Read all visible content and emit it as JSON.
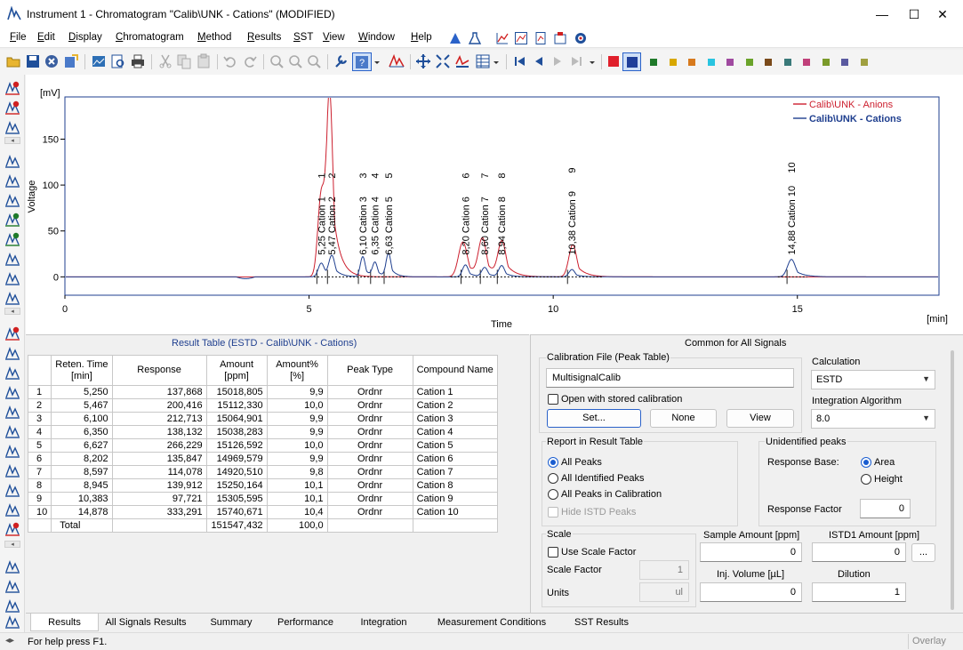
{
  "window": {
    "title": "Instrument 1 - Chromatogram \"Calib\\UNK - Cations\" (MODIFIED)",
    "minimize": "—",
    "maximize": "☐",
    "close": "✕"
  },
  "menu": [
    "File",
    "Edit",
    "Display",
    "Chromatogram",
    "Method",
    "Results",
    "SST",
    "View",
    "Window",
    "Help"
  ],
  "toolbar": {
    "swatch_colors": [
      "#e0202c",
      "#1f3f9a",
      "#1f7a2a",
      "#d8a800",
      "#d77a1e",
      "#29c4e0",
      "#a04aa0",
      "#6aa32a",
      "#7a4a1a",
      "#3a7a7a",
      "#c0407a",
      "#7a9a2a",
      "#5a5aa0",
      "#a0a040"
    ]
  },
  "chart": {
    "y_unit": "[mV]",
    "x_unit": "[min]",
    "y_label": "Voltage",
    "x_label": "Time",
    "legend": [
      {
        "name": "Calib\\UNK - Anions",
        "color": "#cc1f2e"
      },
      {
        "name": "Calib\\UNK - Cations",
        "color": "#1f3f8f"
      }
    ]
  },
  "chart_data": {
    "type": "line",
    "xlim": [
      0,
      17.9
    ],
    "ylim": [
      -20,
      196
    ],
    "x_ticks": [
      0,
      5,
      10,
      15
    ],
    "y_ticks": [
      0,
      50,
      100,
      150
    ],
    "grid": false,
    "legend_position": "top-right",
    "series": [
      {
        "name": "Calib\\UNK - Anions",
        "color": "#cc1f2e",
        "peaks": [
          {
            "t": 5.25,
            "h": 90,
            "w": 0.07
          },
          {
            "t": 5.42,
            "h": 188,
            "w": 0.065
          },
          {
            "t": 8.15,
            "h": 38,
            "w": 0.09
          },
          {
            "t": 8.55,
            "h": 40,
            "w": 0.08
          },
          {
            "t": 8.95,
            "h": 37,
            "w": 0.08
          },
          {
            "t": 10.4,
            "h": 35,
            "w": 0.08
          }
        ]
      },
      {
        "name": "Calib\\UNK - Cations",
        "color": "#1f3f8f",
        "peaks": [
          {
            "t": 5.25,
            "h": 15,
            "w": 0.06
          },
          {
            "t": 5.467,
            "h": 22,
            "w": 0.06
          },
          {
            "t": 6.1,
            "h": 22,
            "w": 0.05
          },
          {
            "t": 6.35,
            "h": 15,
            "w": 0.05
          },
          {
            "t": 6.627,
            "h": 25,
            "w": 0.05
          },
          {
            "t": 8.202,
            "h": 13,
            "w": 0.06
          },
          {
            "t": 8.597,
            "h": 10,
            "w": 0.06
          },
          {
            "t": 8.945,
            "h": 12,
            "w": 0.06
          },
          {
            "t": 10.383,
            "h": 8,
            "w": 0.06
          },
          {
            "t": 14.878,
            "h": 19,
            "w": 0.08
          }
        ]
      }
    ],
    "peak_labels": [
      {
        "t": 5.25,
        "text": "5,25 Cation 1",
        "num": "1"
      },
      {
        "t": 5.467,
        "text": "5,47 Cation 2",
        "num": "2"
      },
      {
        "t": 6.1,
        "text": "6,10 Cation 3",
        "num": "3"
      },
      {
        "t": 6.35,
        "text": "6,35 Cation 4",
        "num": "4"
      },
      {
        "t": 6.627,
        "text": "6,63 Cation 5",
        "num": "5"
      },
      {
        "t": 8.202,
        "text": "8,20 Cation 6",
        "num": "6"
      },
      {
        "t": 8.597,
        "text": "8,60 Cation 7",
        "num": "7"
      },
      {
        "t": 8.945,
        "text": "8,94 Cation 8",
        "num": "8"
      },
      {
        "t": 10.383,
        "text": "10,38 Cation 9",
        "num": "9"
      },
      {
        "t": 14.878,
        "text": "14,88 Cation 10",
        "num": "10"
      }
    ]
  },
  "result_table": {
    "title": "Result Table (ESTD - Calib\\UNK - Cations)",
    "headers": [
      "",
      "Reten. Time\n[min]",
      "Response",
      "Amount\n[ppm]",
      "Amount%\n[%]",
      "Peak Type",
      "Compound Name"
    ],
    "rows": [
      [
        "1",
        "5,250",
        "137,868",
        "15018,805",
        "9,9",
        "Ordnr",
        "Cation 1"
      ],
      [
        "2",
        "5,467",
        "200,416",
        "15112,330",
        "10,0",
        "Ordnr",
        "Cation 2"
      ],
      [
        "3",
        "6,100",
        "212,713",
        "15064,901",
        "9,9",
        "Ordnr",
        "Cation 3"
      ],
      [
        "4",
        "6,350",
        "138,132",
        "15038,283",
        "9,9",
        "Ordnr",
        "Cation 4"
      ],
      [
        "5",
        "6,627",
        "266,229",
        "15126,592",
        "10,0",
        "Ordnr",
        "Cation 5"
      ],
      [
        "6",
        "8,202",
        "135,847",
        "14969,579",
        "9,9",
        "Ordnr",
        "Cation 6"
      ],
      [
        "7",
        "8,597",
        "114,078",
        "14920,510",
        "9,8",
        "Ordnr",
        "Cation 7"
      ],
      [
        "8",
        "8,945",
        "139,912",
        "15250,164",
        "10,1",
        "Ordnr",
        "Cation 8"
      ],
      [
        "9",
        "10,383",
        "97,721",
        "15305,595",
        "10,1",
        "Ordnr",
        "Cation 9"
      ],
      [
        "10",
        "14,878",
        "333,291",
        "15740,671",
        "10,4",
        "Ordnr",
        "Cation 10"
      ]
    ],
    "total": {
      "label": "Total",
      "amount": "151547,432",
      "percent": "100,0"
    }
  },
  "common": {
    "title": "Common for All Signals",
    "calibration_file_label": "Calibration File (Peak Table)",
    "calibration_file_value": "MultisignalCalib",
    "open_with_stored": "Open with stored calibration",
    "set_btn": "Set...",
    "none_btn": "None",
    "view_btn": "View",
    "calculation_label": "Calculation",
    "calculation_value": "ESTD",
    "integration_label": "Integration Algorithm",
    "integration_value": "8.0",
    "report_label": "Report in Result Table",
    "report_all": "All Peaks",
    "report_identified": "All Identified Peaks",
    "report_calibration": "All Peaks in Calibration",
    "hide_istd": "Hide ISTD Peaks",
    "unidentified_label": "Unidentified peaks",
    "response_base_label": "Response Base:",
    "area": "Area",
    "height": "Height",
    "response_factor_label": "Response Factor",
    "response_factor_value": "0",
    "scale_label": "Scale",
    "use_scale": "Use Scale Factor",
    "scale_factor_label": "Scale Factor",
    "scale_factor_value": "1",
    "units_label": "Units",
    "units_value": "ul",
    "sample_amount_label": "Sample Amount  [ppm]",
    "sample_amount_value": "0",
    "istd_label": "ISTD1 Amount  [ppm]",
    "istd_value": "0",
    "more_btn": "...",
    "inj_volume_label": "Inj. Volume  [µL]",
    "inj_volume_value": "0",
    "dilution_label": "Dilution",
    "dilution_value": "1"
  },
  "tabs": [
    "Results",
    "All Signals Results",
    "Summary",
    "Performance",
    "Integration",
    "Measurement Conditions",
    "SST Results"
  ],
  "status": {
    "help": "For help press F1.",
    "overlay": "Overlay"
  }
}
